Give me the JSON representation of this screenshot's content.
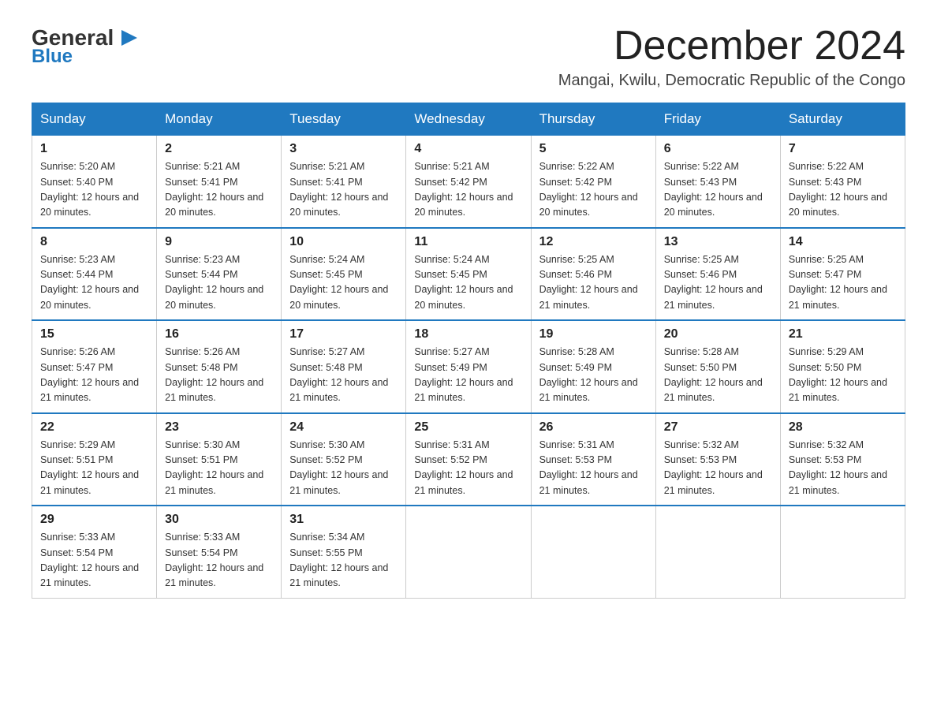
{
  "header": {
    "logo_general": "General",
    "logo_blue": "Blue",
    "month_title": "December 2024",
    "location": "Mangai, Kwilu, Democratic Republic of the Congo"
  },
  "days_of_week": [
    "Sunday",
    "Monday",
    "Tuesday",
    "Wednesday",
    "Thursday",
    "Friday",
    "Saturday"
  ],
  "weeks": [
    [
      {
        "day": "1",
        "sunrise": "5:20 AM",
        "sunset": "5:40 PM",
        "daylight": "12 hours and 20 minutes."
      },
      {
        "day": "2",
        "sunrise": "5:21 AM",
        "sunset": "5:41 PM",
        "daylight": "12 hours and 20 minutes."
      },
      {
        "day": "3",
        "sunrise": "5:21 AM",
        "sunset": "5:41 PM",
        "daylight": "12 hours and 20 minutes."
      },
      {
        "day": "4",
        "sunrise": "5:21 AM",
        "sunset": "5:42 PM",
        "daylight": "12 hours and 20 minutes."
      },
      {
        "day": "5",
        "sunrise": "5:22 AM",
        "sunset": "5:42 PM",
        "daylight": "12 hours and 20 minutes."
      },
      {
        "day": "6",
        "sunrise": "5:22 AM",
        "sunset": "5:43 PM",
        "daylight": "12 hours and 20 minutes."
      },
      {
        "day": "7",
        "sunrise": "5:22 AM",
        "sunset": "5:43 PM",
        "daylight": "12 hours and 20 minutes."
      }
    ],
    [
      {
        "day": "8",
        "sunrise": "5:23 AM",
        "sunset": "5:44 PM",
        "daylight": "12 hours and 20 minutes."
      },
      {
        "day": "9",
        "sunrise": "5:23 AM",
        "sunset": "5:44 PM",
        "daylight": "12 hours and 20 minutes."
      },
      {
        "day": "10",
        "sunrise": "5:24 AM",
        "sunset": "5:45 PM",
        "daylight": "12 hours and 20 minutes."
      },
      {
        "day": "11",
        "sunrise": "5:24 AM",
        "sunset": "5:45 PM",
        "daylight": "12 hours and 20 minutes."
      },
      {
        "day": "12",
        "sunrise": "5:25 AM",
        "sunset": "5:46 PM",
        "daylight": "12 hours and 21 minutes."
      },
      {
        "day": "13",
        "sunrise": "5:25 AM",
        "sunset": "5:46 PM",
        "daylight": "12 hours and 21 minutes."
      },
      {
        "day": "14",
        "sunrise": "5:25 AM",
        "sunset": "5:47 PM",
        "daylight": "12 hours and 21 minutes."
      }
    ],
    [
      {
        "day": "15",
        "sunrise": "5:26 AM",
        "sunset": "5:47 PM",
        "daylight": "12 hours and 21 minutes."
      },
      {
        "day": "16",
        "sunrise": "5:26 AM",
        "sunset": "5:48 PM",
        "daylight": "12 hours and 21 minutes."
      },
      {
        "day": "17",
        "sunrise": "5:27 AM",
        "sunset": "5:48 PM",
        "daylight": "12 hours and 21 minutes."
      },
      {
        "day": "18",
        "sunrise": "5:27 AM",
        "sunset": "5:49 PM",
        "daylight": "12 hours and 21 minutes."
      },
      {
        "day": "19",
        "sunrise": "5:28 AM",
        "sunset": "5:49 PM",
        "daylight": "12 hours and 21 minutes."
      },
      {
        "day": "20",
        "sunrise": "5:28 AM",
        "sunset": "5:50 PM",
        "daylight": "12 hours and 21 minutes."
      },
      {
        "day": "21",
        "sunrise": "5:29 AM",
        "sunset": "5:50 PM",
        "daylight": "12 hours and 21 minutes."
      }
    ],
    [
      {
        "day": "22",
        "sunrise": "5:29 AM",
        "sunset": "5:51 PM",
        "daylight": "12 hours and 21 minutes."
      },
      {
        "day": "23",
        "sunrise": "5:30 AM",
        "sunset": "5:51 PM",
        "daylight": "12 hours and 21 minutes."
      },
      {
        "day": "24",
        "sunrise": "5:30 AM",
        "sunset": "5:52 PM",
        "daylight": "12 hours and 21 minutes."
      },
      {
        "day": "25",
        "sunrise": "5:31 AM",
        "sunset": "5:52 PM",
        "daylight": "12 hours and 21 minutes."
      },
      {
        "day": "26",
        "sunrise": "5:31 AM",
        "sunset": "5:53 PM",
        "daylight": "12 hours and 21 minutes."
      },
      {
        "day": "27",
        "sunrise": "5:32 AM",
        "sunset": "5:53 PM",
        "daylight": "12 hours and 21 minutes."
      },
      {
        "day": "28",
        "sunrise": "5:32 AM",
        "sunset": "5:53 PM",
        "daylight": "12 hours and 21 minutes."
      }
    ],
    [
      {
        "day": "29",
        "sunrise": "5:33 AM",
        "sunset": "5:54 PM",
        "daylight": "12 hours and 21 minutes."
      },
      {
        "day": "30",
        "sunrise": "5:33 AM",
        "sunset": "5:54 PM",
        "daylight": "12 hours and 21 minutes."
      },
      {
        "day": "31",
        "sunrise": "5:34 AM",
        "sunset": "5:55 PM",
        "daylight": "12 hours and 21 minutes."
      },
      null,
      null,
      null,
      null
    ]
  ]
}
